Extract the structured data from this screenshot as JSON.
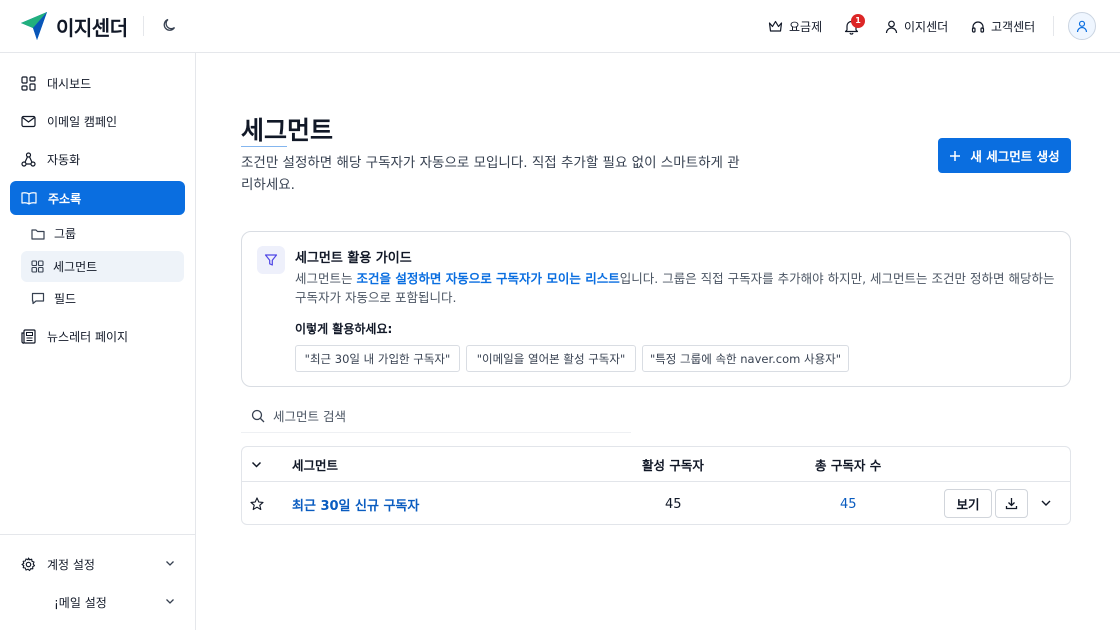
{
  "brand": {
    "name": "이지센더",
    "accent": "#0a6ee0"
  },
  "header": {
    "pricing": "요금제",
    "notification_count": "1",
    "account": "이지센더",
    "support": "고객센터"
  },
  "sidebar": {
    "items": [
      {
        "label": "대시보드",
        "icon": "dashboard-icon"
      },
      {
        "label": "이메일 캠페인",
        "icon": "mail-icon"
      },
      {
        "label": "자동화",
        "icon": "automation-icon"
      },
      {
        "label": "주소록",
        "icon": "book-icon",
        "active": true
      }
    ],
    "sub_items": [
      {
        "label": "그룹",
        "icon": "folder-icon"
      },
      {
        "label": "세그먼트",
        "icon": "grid-icon",
        "active": true
      },
      {
        "label": "필드",
        "icon": "chat-icon"
      }
    ],
    "newsletter": "뉴스레터 페이지",
    "account_settings": "계정 설정",
    "mail_settings": "¡메일 설정"
  },
  "main": {
    "title": "세그먼트",
    "description": "조건만 설정하면 해당 구독자가 자동으로 모입니다. 직접 추가할 필요 없이 스마트하게 관리하세요.",
    "new_button": "새 세그먼트 생성"
  },
  "guide": {
    "title": "세그먼트 활용 가이드",
    "text_before": "세그먼트는 ",
    "text_highlight": "조건을 설정하면 자동으로 구독자가 모이는 리스트",
    "text_after": "입니다. 그룹은 직접 구독자를 추가해야 하지만, 세그먼트는 조건만 정하면 해당하는 구독자가 자동으로 포함됩니다.",
    "subtitle": "이렇게 활용하세요:",
    "examples": [
      "\"최근 30일 내 가입한 구독자\"",
      "\"이메일을 열어본 활성 구독자\"",
      "\"특정 그룹에 속한 naver.com 사용자\""
    ]
  },
  "search": {
    "placeholder": "세그먼트 검색"
  },
  "table": {
    "columns": [
      "세그먼트",
      "활성 구독자",
      "총 구독자 수"
    ],
    "rows": [
      {
        "name": "최근 30일 신규 구독자",
        "active": "45",
        "total": "45",
        "view_label": "보기"
      }
    ]
  }
}
